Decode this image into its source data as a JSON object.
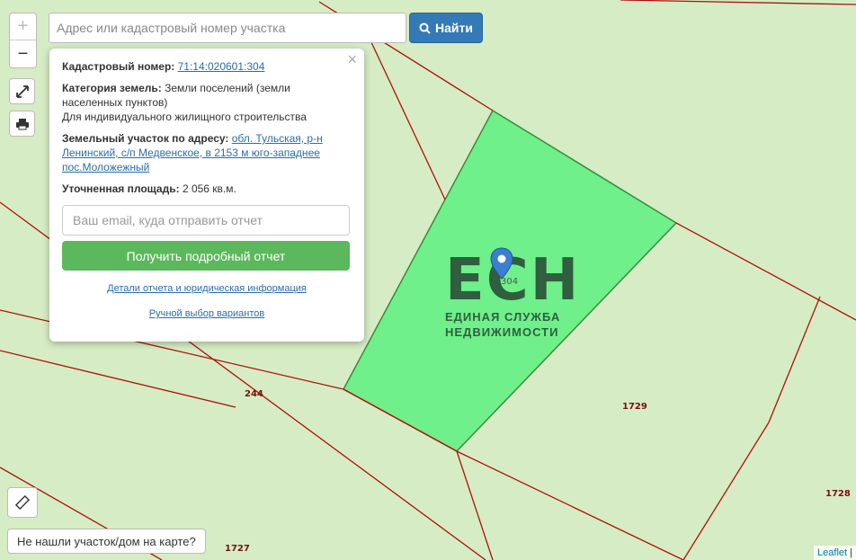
{
  "search": {
    "placeholder": "Адрес или кадастровый номер участка",
    "button_label": "Найти"
  },
  "map_controls": {
    "zoom_in": "+",
    "zoom_out": "−"
  },
  "popup": {
    "close_label": "×",
    "cadastral_label": "Кадастровый номер:",
    "cadastral_value": "71:14:020601:304",
    "category_label": "Категория земель:",
    "category_value": "Земли поселений (земли населенных пунктов)",
    "usage": "Для индивидуального жилищного строительства",
    "address_label": "Земельный участок по адресу:",
    "address_value": "обл. Тульская, р-н Ленинский, с/п Медвенское, в 2153 м юго-западнее пос.Моложежный",
    "area_label": "Уточненная площадь:",
    "area_value": "2 056 кв.м.",
    "email_placeholder": "Ваш email, куда отправить отчет",
    "report_button": "Получить подробный отчет",
    "details_link": "Детали отчета и юридическая информация",
    "manual_link": "Ручной выбор вариантов"
  },
  "plots": {
    "selected": "304",
    "p244": "244",
    "p1729": "1729",
    "p1728": "1728",
    "p1727": "1727"
  },
  "watermark": {
    "big": "ЕСН",
    "line1": "ЕДИНАЯ СЛУЖБА",
    "line2": "НЕДВИЖИМОСТИ"
  },
  "not_found_button": "Не нашли участок/дом на карте?",
  "attribution": {
    "link": "Leaflet",
    "separator": " |"
  },
  "colors": {
    "map_bg": "#d6ecc4",
    "selected_plot": "#6ff08a",
    "boundary": "#b01010",
    "primary": "#337ab7",
    "success": "#5cb85c"
  },
  "icons": [
    "search-icon",
    "fullscreen-icon",
    "print-icon",
    "ruler-icon",
    "map-marker-icon"
  ]
}
